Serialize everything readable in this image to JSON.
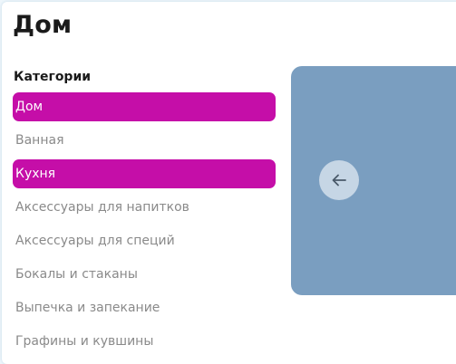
{
  "page": {
    "title": "Дом"
  },
  "categories": {
    "heading": "Категории",
    "items": [
      {
        "label": "Дом",
        "active": true
      },
      {
        "label": "Ванная",
        "active": false
      },
      {
        "label": "Кухня",
        "active": true
      },
      {
        "label": "Аксессуары для напитков",
        "active": false
      },
      {
        "label": "Аксессуары для специй",
        "active": false
      },
      {
        "label": "Бокалы и стаканы",
        "active": false
      },
      {
        "label": "Выпечка и запекание",
        "active": false
      },
      {
        "label": "Графины и кувшины",
        "active": false
      }
    ]
  },
  "carousel": {
    "prev_icon": "arrow-left-icon"
  },
  "colors": {
    "accent": "#c50ea8",
    "hero_bg": "#7a9ec0",
    "muted_text": "#8a8a8a"
  }
}
